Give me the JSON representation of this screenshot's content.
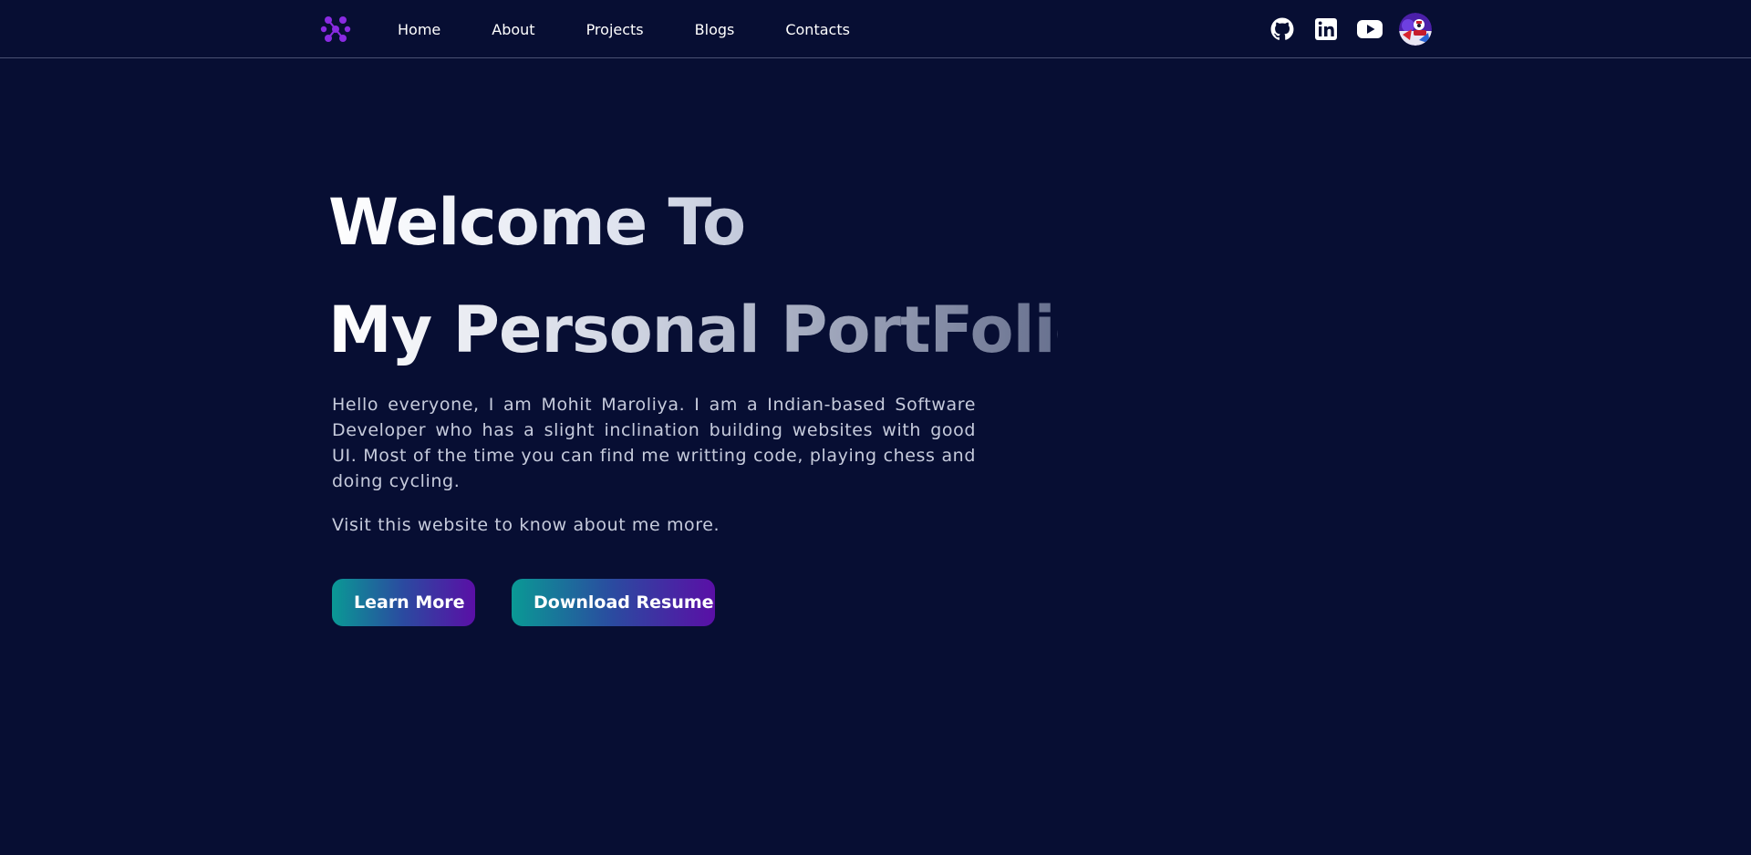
{
  "nav": {
    "logo_icon": "asterisk-logo-icon",
    "links": [
      {
        "label": "Home"
      },
      {
        "label": "About"
      },
      {
        "label": "Projects"
      },
      {
        "label": "Blogs"
      },
      {
        "label": "Contacts"
      }
    ],
    "social": [
      {
        "icon": "github-icon"
      },
      {
        "icon": "linkedin-icon"
      },
      {
        "icon": "youtube-icon"
      },
      {
        "icon": "avatar-icon"
      }
    ]
  },
  "hero": {
    "line1": "Welcome To",
    "line2": "My Personal PortFolio",
    "intro": "Hello everyone, I am Mohit Maroliya. I am a Indian-based Software Developer who has a slight inclination building websites with good UI. Most of the time you can find me writting code, playing chess and doing cycling.",
    "visit": "Visit this website to know about me more.",
    "learn_more": "Learn More",
    "download_resume": "Download Resume"
  },
  "colors": {
    "background": "#070e33",
    "logo": "#8a2be2",
    "button_gradient_start": "#0a9995",
    "button_gradient_end": "#5a0fa6"
  }
}
